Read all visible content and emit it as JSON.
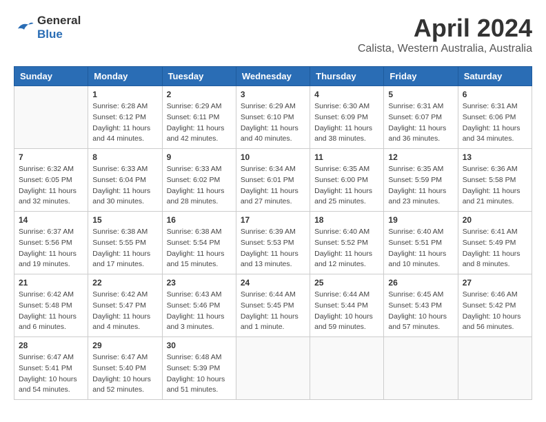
{
  "header": {
    "logo_line1": "General",
    "logo_line2": "Blue",
    "month": "April 2024",
    "location": "Calista, Western Australia, Australia"
  },
  "days_of_week": [
    "Sunday",
    "Monday",
    "Tuesday",
    "Wednesday",
    "Thursday",
    "Friday",
    "Saturday"
  ],
  "weeks": [
    [
      {
        "day": "",
        "sunrise": "",
        "sunset": "",
        "daylight": ""
      },
      {
        "day": "1",
        "sunrise": "Sunrise: 6:28 AM",
        "sunset": "Sunset: 6:12 PM",
        "daylight": "Daylight: 11 hours and 44 minutes."
      },
      {
        "day": "2",
        "sunrise": "Sunrise: 6:29 AM",
        "sunset": "Sunset: 6:11 PM",
        "daylight": "Daylight: 11 hours and 42 minutes."
      },
      {
        "day": "3",
        "sunrise": "Sunrise: 6:29 AM",
        "sunset": "Sunset: 6:10 PM",
        "daylight": "Daylight: 11 hours and 40 minutes."
      },
      {
        "day": "4",
        "sunrise": "Sunrise: 6:30 AM",
        "sunset": "Sunset: 6:09 PM",
        "daylight": "Daylight: 11 hours and 38 minutes."
      },
      {
        "day": "5",
        "sunrise": "Sunrise: 6:31 AM",
        "sunset": "Sunset: 6:07 PM",
        "daylight": "Daylight: 11 hours and 36 minutes."
      },
      {
        "day": "6",
        "sunrise": "Sunrise: 6:31 AM",
        "sunset": "Sunset: 6:06 PM",
        "daylight": "Daylight: 11 hours and 34 minutes."
      }
    ],
    [
      {
        "day": "7",
        "sunrise": "Sunrise: 6:32 AM",
        "sunset": "Sunset: 6:05 PM",
        "daylight": "Daylight: 11 hours and 32 minutes."
      },
      {
        "day": "8",
        "sunrise": "Sunrise: 6:33 AM",
        "sunset": "Sunset: 6:04 PM",
        "daylight": "Daylight: 11 hours and 30 minutes."
      },
      {
        "day": "9",
        "sunrise": "Sunrise: 6:33 AM",
        "sunset": "Sunset: 6:02 PM",
        "daylight": "Daylight: 11 hours and 28 minutes."
      },
      {
        "day": "10",
        "sunrise": "Sunrise: 6:34 AM",
        "sunset": "Sunset: 6:01 PM",
        "daylight": "Daylight: 11 hours and 27 minutes."
      },
      {
        "day": "11",
        "sunrise": "Sunrise: 6:35 AM",
        "sunset": "Sunset: 6:00 PM",
        "daylight": "Daylight: 11 hours and 25 minutes."
      },
      {
        "day": "12",
        "sunrise": "Sunrise: 6:35 AM",
        "sunset": "Sunset: 5:59 PM",
        "daylight": "Daylight: 11 hours and 23 minutes."
      },
      {
        "day": "13",
        "sunrise": "Sunrise: 6:36 AM",
        "sunset": "Sunset: 5:58 PM",
        "daylight": "Daylight: 11 hours and 21 minutes."
      }
    ],
    [
      {
        "day": "14",
        "sunrise": "Sunrise: 6:37 AM",
        "sunset": "Sunset: 5:56 PM",
        "daylight": "Daylight: 11 hours and 19 minutes."
      },
      {
        "day": "15",
        "sunrise": "Sunrise: 6:38 AM",
        "sunset": "Sunset: 5:55 PM",
        "daylight": "Daylight: 11 hours and 17 minutes."
      },
      {
        "day": "16",
        "sunrise": "Sunrise: 6:38 AM",
        "sunset": "Sunset: 5:54 PM",
        "daylight": "Daylight: 11 hours and 15 minutes."
      },
      {
        "day": "17",
        "sunrise": "Sunrise: 6:39 AM",
        "sunset": "Sunset: 5:53 PM",
        "daylight": "Daylight: 11 hours and 13 minutes."
      },
      {
        "day": "18",
        "sunrise": "Sunrise: 6:40 AM",
        "sunset": "Sunset: 5:52 PM",
        "daylight": "Daylight: 11 hours and 12 minutes."
      },
      {
        "day": "19",
        "sunrise": "Sunrise: 6:40 AM",
        "sunset": "Sunset: 5:51 PM",
        "daylight": "Daylight: 11 hours and 10 minutes."
      },
      {
        "day": "20",
        "sunrise": "Sunrise: 6:41 AM",
        "sunset": "Sunset: 5:49 PM",
        "daylight": "Daylight: 11 hours and 8 minutes."
      }
    ],
    [
      {
        "day": "21",
        "sunrise": "Sunrise: 6:42 AM",
        "sunset": "Sunset: 5:48 PM",
        "daylight": "Daylight: 11 hours and 6 minutes."
      },
      {
        "day": "22",
        "sunrise": "Sunrise: 6:42 AM",
        "sunset": "Sunset: 5:47 PM",
        "daylight": "Daylight: 11 hours and 4 minutes."
      },
      {
        "day": "23",
        "sunrise": "Sunrise: 6:43 AM",
        "sunset": "Sunset: 5:46 PM",
        "daylight": "Daylight: 11 hours and 3 minutes."
      },
      {
        "day": "24",
        "sunrise": "Sunrise: 6:44 AM",
        "sunset": "Sunset: 5:45 PM",
        "daylight": "Daylight: 11 hours and 1 minute."
      },
      {
        "day": "25",
        "sunrise": "Sunrise: 6:44 AM",
        "sunset": "Sunset: 5:44 PM",
        "daylight": "Daylight: 10 hours and 59 minutes."
      },
      {
        "day": "26",
        "sunrise": "Sunrise: 6:45 AM",
        "sunset": "Sunset: 5:43 PM",
        "daylight": "Daylight: 10 hours and 57 minutes."
      },
      {
        "day": "27",
        "sunrise": "Sunrise: 6:46 AM",
        "sunset": "Sunset: 5:42 PM",
        "daylight": "Daylight: 10 hours and 56 minutes."
      }
    ],
    [
      {
        "day": "28",
        "sunrise": "Sunrise: 6:47 AM",
        "sunset": "Sunset: 5:41 PM",
        "daylight": "Daylight: 10 hours and 54 minutes."
      },
      {
        "day": "29",
        "sunrise": "Sunrise: 6:47 AM",
        "sunset": "Sunset: 5:40 PM",
        "daylight": "Daylight: 10 hours and 52 minutes."
      },
      {
        "day": "30",
        "sunrise": "Sunrise: 6:48 AM",
        "sunset": "Sunset: 5:39 PM",
        "daylight": "Daylight: 10 hours and 51 minutes."
      },
      {
        "day": "",
        "sunrise": "",
        "sunset": "",
        "daylight": ""
      },
      {
        "day": "",
        "sunrise": "",
        "sunset": "",
        "daylight": ""
      },
      {
        "day": "",
        "sunrise": "",
        "sunset": "",
        "daylight": ""
      },
      {
        "day": "",
        "sunrise": "",
        "sunset": "",
        "daylight": ""
      }
    ]
  ]
}
